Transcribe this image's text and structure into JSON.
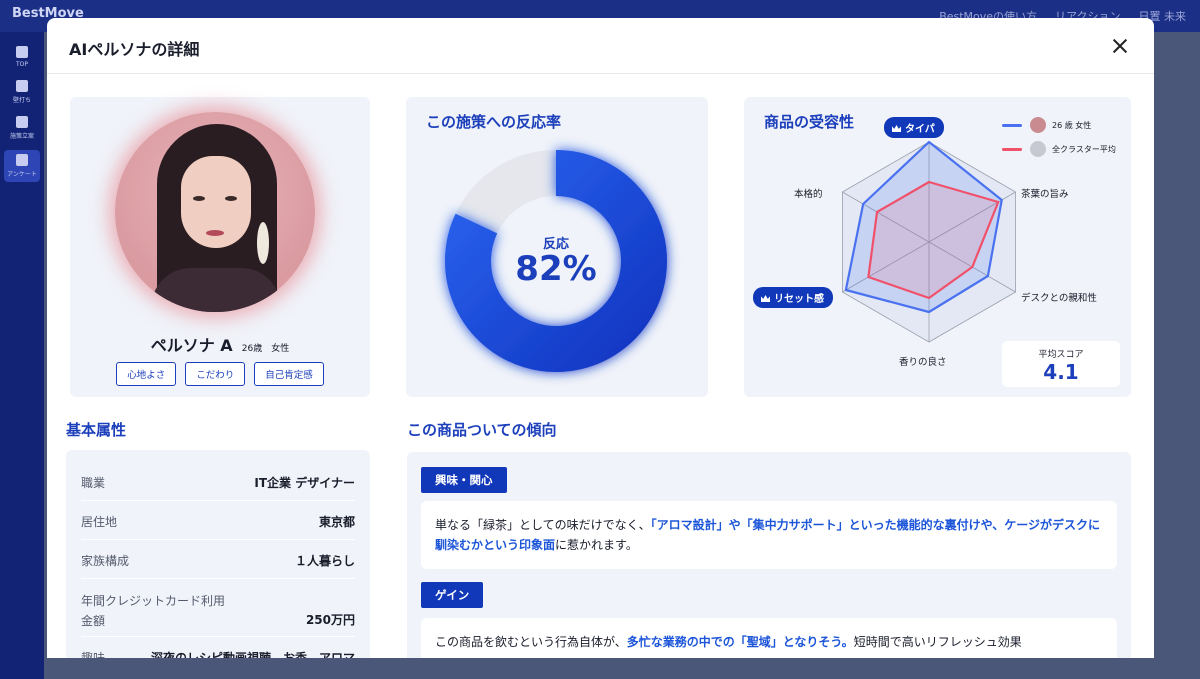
{
  "app": {
    "brand": "BestMove",
    "top_links": [
      "BestMoveの使い方",
      "リアクション",
      "日置 未来"
    ],
    "sidebar": [
      {
        "label": "TOP",
        "icon": "home-icon"
      },
      {
        "label": "壁打ち",
        "icon": "chat-icon"
      },
      {
        "label": "施策立案",
        "icon": "bulb-icon"
      },
      {
        "label": "アンケート",
        "icon": "survey-icon",
        "active": true
      }
    ]
  },
  "modal": {
    "title": "AIペルソナの詳細",
    "close_icon": "close-icon"
  },
  "persona": {
    "name": "ペルソナ A",
    "meta": "26歳　女性",
    "tags": [
      "心地よさ",
      "こだわり",
      "自己肯定感"
    ]
  },
  "reaction": {
    "title": "この施策への反応率",
    "label": "反応",
    "value_text": "82%",
    "percent": 82
  },
  "acceptance": {
    "title": "商品の受容性",
    "axes": [
      "タイパ",
      "茶葉の旨み",
      "デスクとの親和性",
      "香りの良さ",
      "リセット感",
      "本格的"
    ],
    "highlighted_axes": [
      "タイパ",
      "リセット感"
    ],
    "legend": [
      "26 歳 女性",
      "全クラスター平均"
    ],
    "score_label": "平均スコア",
    "score_value": "4.1",
    "colors": {
      "persona": "#4a72f0",
      "average": "#f0506a"
    }
  },
  "chart_data": {
    "type": "radar",
    "categories": [
      "タイパ",
      "茶葉の旨み",
      "デスクとの親和性",
      "香りの良さ",
      "リセット感",
      "本格的"
    ],
    "rmax": 5,
    "series": [
      {
        "name": "26 歳 女性",
        "values": [
          5,
          4.2,
          3.4,
          3.5,
          4.8,
          3.8
        ]
      },
      {
        "name": "全クラスター平均",
        "values": [
          3,
          4.0,
          2.5,
          2.8,
          3.5,
          3.0
        ]
      }
    ]
  },
  "attributes": {
    "title": "基本属性",
    "rows": [
      {
        "key": "職業",
        "value": "IT企業 デザイナー"
      },
      {
        "key": "居住地",
        "value": "東京都"
      },
      {
        "key": "家族構成",
        "value": "１人暮らし"
      },
      {
        "key": "年間クレジットカード利用金額",
        "value": "250万円"
      },
      {
        "key": "趣味",
        "value": "深夜のレシピ動画視聴、お香、アロマ"
      }
    ]
  },
  "tendency": {
    "title": "この商品ついての傾向",
    "sections": [
      {
        "heading": "興味・関心",
        "parts": [
          {
            "t": "単なる「緑茶」としての味だけでなく、",
            "hl": false
          },
          {
            "t": "「アロマ設計」や「集中力サポート」といった機能的な裏付けや、ケージがデスクに馴染むかという印象面",
            "hl": true
          },
          {
            "t": "に惹かれます。",
            "hl": false
          }
        ]
      },
      {
        "heading": "ゲイン",
        "parts": [
          {
            "t": "この商品を飲むという行為自体が、",
            "hl": false
          },
          {
            "t": "多忙な業務の中での「聖域」となりそう。",
            "hl": true
          },
          {
            "t": "短時間で高いリフレッシュ効果",
            "hl": false
          }
        ]
      }
    ]
  }
}
